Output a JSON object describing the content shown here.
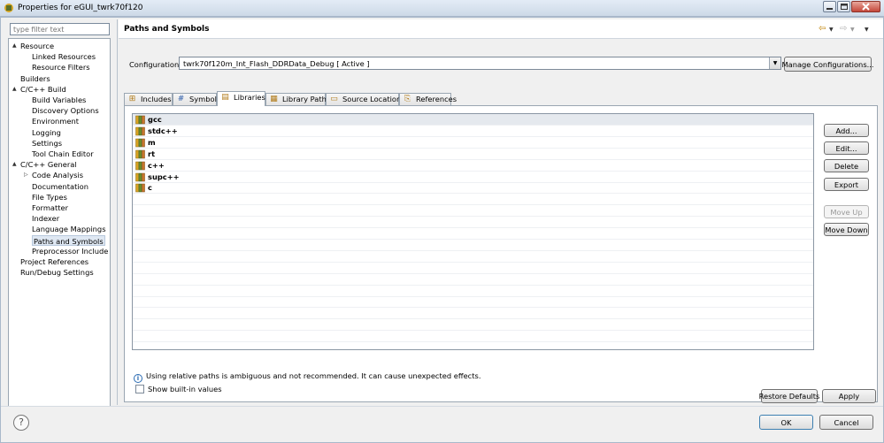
{
  "window": {
    "title": "Properties for eGUI_twrk70f120"
  },
  "filter": {
    "placeholder": "type filter text"
  },
  "tree": [
    {
      "label": "Resource",
      "level": 0,
      "expander": "▲"
    },
    {
      "label": "Linked Resources",
      "level": 1
    },
    {
      "label": "Resource Filters",
      "level": 1
    },
    {
      "label": "Builders",
      "level": 0
    },
    {
      "label": "C/C++ Build",
      "level": 0,
      "expander": "▲"
    },
    {
      "label": "Build Variables",
      "level": 1
    },
    {
      "label": "Discovery Options",
      "level": 1
    },
    {
      "label": "Environment",
      "level": 1
    },
    {
      "label": "Logging",
      "level": 1
    },
    {
      "label": "Settings",
      "level": 1
    },
    {
      "label": "Tool Chain Editor",
      "level": 1
    },
    {
      "label": "C/C++ General",
      "level": 0,
      "expander": "▲"
    },
    {
      "label": "Code Analysis",
      "level": 1,
      "expander": "▷"
    },
    {
      "label": "Documentation",
      "level": 1
    },
    {
      "label": "File Types",
      "level": 1
    },
    {
      "label": "Formatter",
      "level": 1
    },
    {
      "label": "Indexer",
      "level": 1
    },
    {
      "label": "Language Mappings",
      "level": 1
    },
    {
      "label": "Paths and Symbols",
      "level": 1,
      "selected": true
    },
    {
      "label": "Preprocessor Include Pa",
      "level": 1
    },
    {
      "label": "Project References",
      "level": 0
    },
    {
      "label": "Run/Debug Settings",
      "level": 0
    }
  ],
  "page": {
    "title": "Paths and Symbols"
  },
  "config": {
    "label": "Configuration:",
    "value": "twrk70f120m_Int_Flash_DDRData_Debug  [ Active ]",
    "manage_label": "Manage Configurations..."
  },
  "tabs": [
    {
      "label": "Includes",
      "icon": "includes-icon"
    },
    {
      "label": "Symbols",
      "icon": "hash-icon"
    },
    {
      "label": "Libraries",
      "icon": "library-icon",
      "active": true
    },
    {
      "label": "Library Paths",
      "icon": "library-path-icon"
    },
    {
      "label": "Source Location",
      "icon": "folder-icon"
    },
    {
      "label": "References",
      "icon": "references-icon"
    }
  ],
  "libraries": [
    "gcc",
    "stdc++",
    "m",
    "rt",
    "c++",
    "supc++",
    "c"
  ],
  "side_buttons": {
    "add": "Add...",
    "edit": "Edit...",
    "delete": "Delete",
    "export": "Export",
    "move_up": "Move Up",
    "move_down": "Move Down"
  },
  "info_text": "Using relative paths is ambiguous and not recommended. It can cause unexpected effects.",
  "show_builtin_label": "Show built-in values",
  "footer": {
    "restore_defaults": "Restore Defaults",
    "apply": "Apply",
    "ok": "OK",
    "cancel": "Cancel",
    "help": "?"
  },
  "colors": {
    "accent": "#3c7fb1",
    "selection": "#dfe8f3",
    "close": "#c4473a"
  }
}
